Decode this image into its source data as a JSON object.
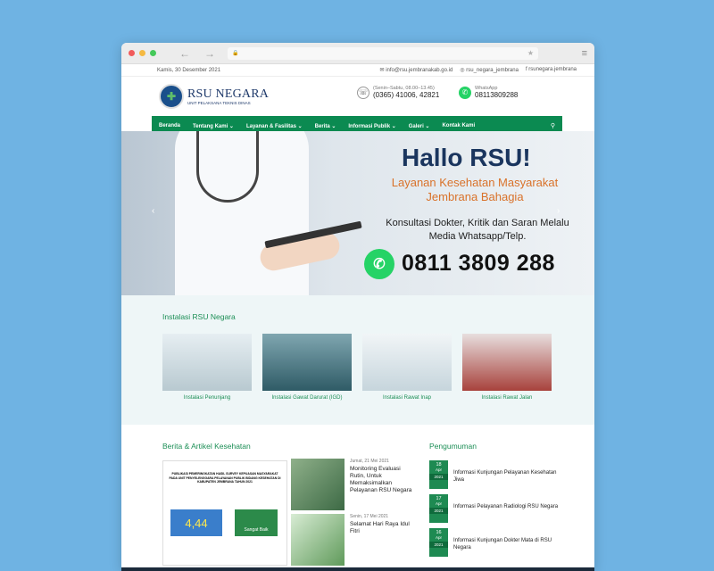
{
  "browser": {
    "dots": [
      "#f15b5b",
      "#f5b942",
      "#45c95a"
    ],
    "back": "←",
    "forward": "→",
    "lock": "🔒",
    "star": "★",
    "menu": "≡"
  },
  "topbar": {
    "date": "Kamis, 30 Desember 2021",
    "email": "info@rsu.jembranakab.go.id",
    "instagram": "rsu_negara_jembrana",
    "facebook": "rsunegara.jembrana"
  },
  "header": {
    "brand_name": "RSU NEGARA",
    "brand_sub": "UNIT PELAKSANA TEKNIS DINAS",
    "hours": "(Senin–Sabtu, 08.00–13.45)",
    "phone": "(0365) 41006, 42821",
    "wa_label": "WhatsApp",
    "wa_number": "08113809288"
  },
  "nav": [
    {
      "label": "Beranda"
    },
    {
      "label": "Tentang Kami ⌄"
    },
    {
      "label": "Layanan & Fasilitas ⌄"
    },
    {
      "label": "Berita ⌄"
    },
    {
      "label": "Informasi Publik ⌄"
    },
    {
      "label": "Galeri ⌄"
    },
    {
      "label": "Kontak Kami"
    }
  ],
  "hero": {
    "title": "Hallo RSU!",
    "subtitle": "Layanan Kesehatan Masyarakat Jembrana Bahagia",
    "text": "Konsultasi Dokter, Kritik dan Saran Melalu Media Whatsapp/Telp.",
    "phone": "0811 3809 288",
    "prev": "‹",
    "next": "›"
  },
  "instalasi": {
    "title": "Instalasi RSU Negara",
    "items": [
      {
        "label": "Instalasi Penunjang",
        "color": "#c9d8de"
      },
      {
        "label": "Instalasi Gawat Darurat (IGD)",
        "color": "#3f6f7a"
      },
      {
        "label": "Instalasi Rawat Inap",
        "color": "#dfe8ec"
      },
      {
        "label": "Instalasi Rawat Jalan",
        "color": "#b5504a"
      }
    ]
  },
  "berita": {
    "title": "Berita & Artikel Kesehatan",
    "poster_title": "PUBLIKASI PEMERINGKATAN HASIL SURVEY KEPUASAN MASYARAKAT PADA UNIT PENYELENGGARA PELAYANAN PUBLIK BIDANG KESEHATAN DI KABUPATEN JEMBRANA TAHUN 2021",
    "poster_score": "4,44",
    "poster_grade": "Sangat Baik",
    "items": [
      {
        "date": "Jumat, 21 Mei 2021",
        "title": "Monitoring Evaluasi Rutin, Untuk Memaksimalkan Pelayanan RSU Negara"
      },
      {
        "date": "Senin, 17 Mei 2021",
        "title": "Selamat Hari Raya Idul Fitri"
      }
    ]
  },
  "pengumuman": {
    "title": "Pengumuman",
    "items": [
      {
        "day": "18",
        "month": "Apr",
        "year": "2021",
        "title": "Informasi Kunjungan Pelayanan Kesehatan Jiwa"
      },
      {
        "day": "17",
        "month": "Apr",
        "year": "2021",
        "title": "Informasi Pelayanan Radiologi RSU Negara"
      },
      {
        "day": "16",
        "month": "Apr",
        "year": "2021",
        "title": "Informasi Kunjungan Dokter Mata di RSU Negara"
      }
    ]
  }
}
